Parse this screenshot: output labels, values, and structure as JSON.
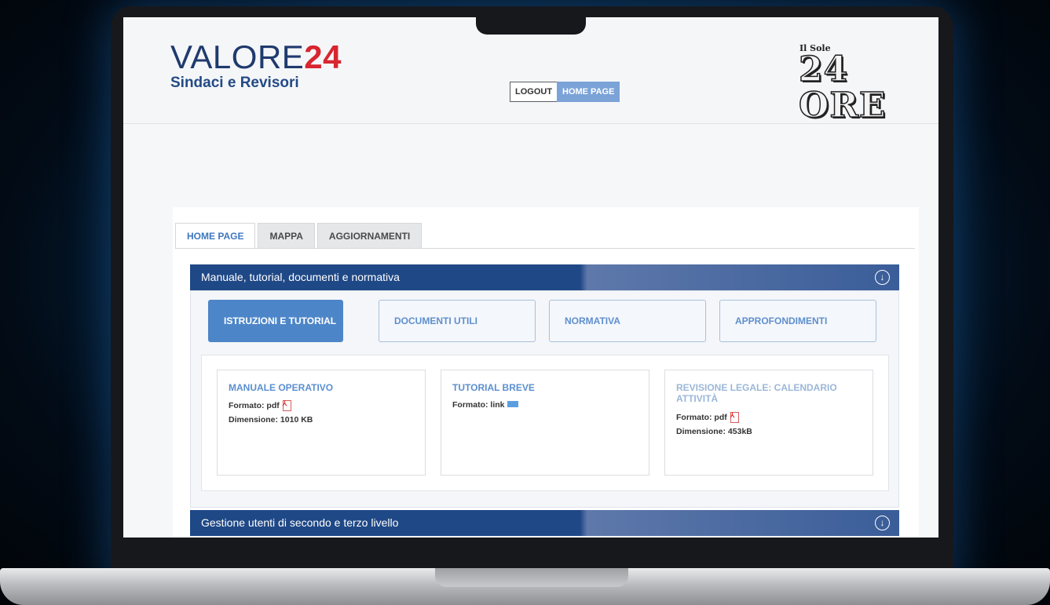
{
  "header": {
    "logo_text": "VALORE",
    "logo_number": "24",
    "logo_subtitle": "Sindaci e Revisori",
    "logout_label": "LOGOUT",
    "home_label": "HOME PAGE",
    "publisher_small": "Il Sole",
    "publisher_big": "24 ORE"
  },
  "tabs": [
    {
      "label": "HOME PAGE",
      "active": true
    },
    {
      "label": "MAPPA",
      "active": false
    },
    {
      "label": "AGGIORNAMENTI",
      "active": false
    }
  ],
  "sections": [
    {
      "title": "Manuale, tutorial, documenti e normativa",
      "icon": "chevron-down-circle-icon"
    },
    {
      "title": "Gestione utenti di secondo e terzo livello",
      "icon": "chevron-down-circle-icon"
    }
  ],
  "categories": [
    {
      "label": "ISTRUZIONI E TUTORIAL",
      "active": true
    },
    {
      "label": "DOCUMENTI UTILI",
      "active": false
    },
    {
      "label": "NORMATIVA",
      "active": false
    },
    {
      "label": "APPROFONDIMENTI",
      "active": false
    }
  ],
  "cards": [
    {
      "title": "MANUALE OPERATIVO",
      "format": "Formato: pdf",
      "format_icon": "pdf-icon",
      "size": "Dimensione: 1010 KB"
    },
    {
      "title": "TUTORIAL BREVE",
      "format": "Formato: link",
      "format_icon": "link-icon",
      "size": ""
    },
    {
      "title": "REVISIONE LEGALE: CALENDARIO ATTIVITÀ",
      "format": "Formato: pdf",
      "format_icon": "pdf-icon",
      "size": "Dimensione: 453kB"
    }
  ],
  "colors": {
    "brand_blue": "#1f4886",
    "accent_red": "#d7262f",
    "link_blue": "#5b8fcf"
  }
}
